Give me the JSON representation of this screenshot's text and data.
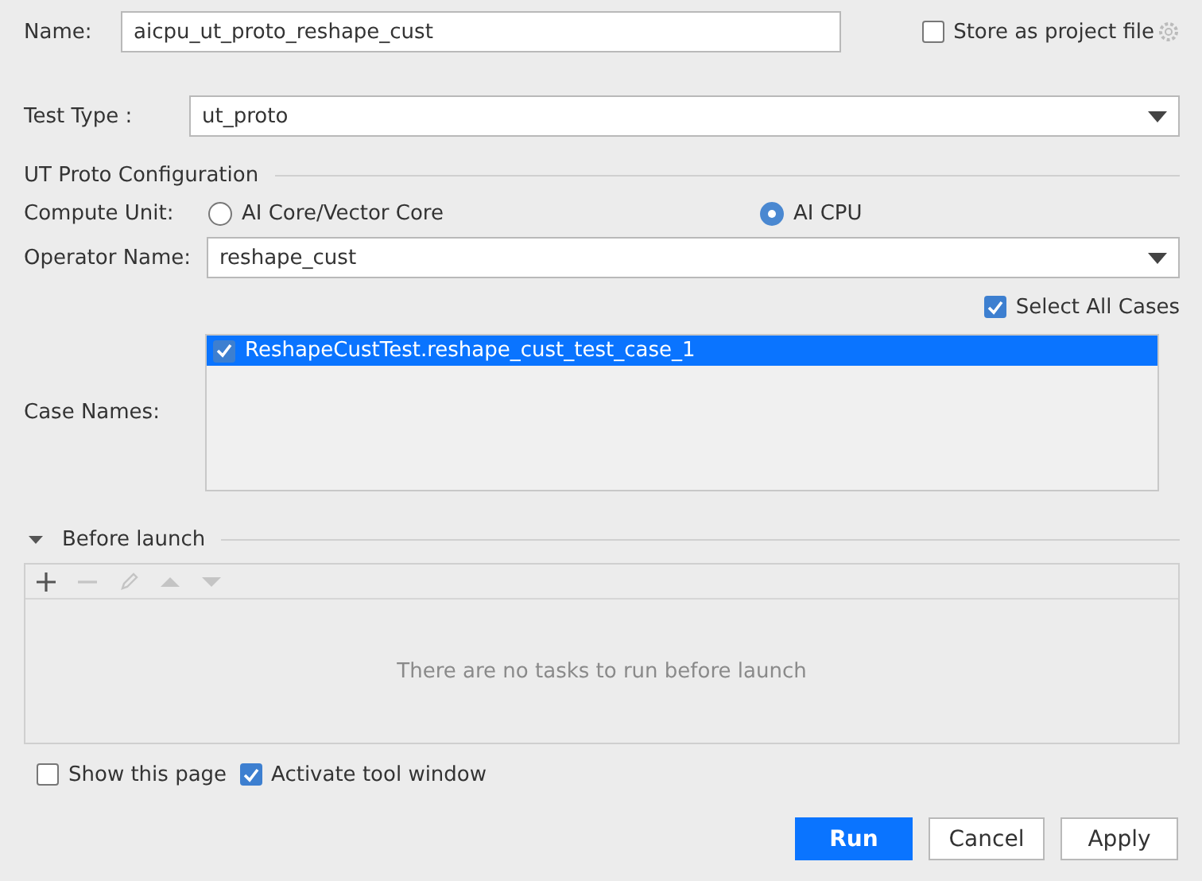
{
  "name_field": {
    "label": "Name:",
    "value": "aicpu_ut_proto_reshape_cust"
  },
  "store_as_project_file": {
    "label": "Store as project file",
    "checked": false
  },
  "test_type": {
    "label": "Test Type :",
    "value": "ut_proto"
  },
  "ut_proto_configuration": {
    "title": "UT Proto Configuration",
    "compute_unit": {
      "label": "Compute Unit:",
      "options": [
        {
          "label": "AI Core/Vector Core",
          "selected": false
        },
        {
          "label": "AI CPU",
          "selected": true
        }
      ]
    },
    "operator_name": {
      "label": "Operator Name:",
      "value": "reshape_cust"
    },
    "select_all_cases": {
      "label": "Select All Cases",
      "checked": true
    },
    "case_names": {
      "label": "Case Names:",
      "items": [
        {
          "label": "ReshapeCustTest.reshape_cust_test_case_1",
          "checked": true,
          "selected": true
        }
      ]
    }
  },
  "before_launch": {
    "title": "Before launch",
    "expanded": true,
    "toolbar": [
      {
        "kind": "add",
        "disabled": false
      },
      {
        "kind": "remove",
        "disabled": true
      },
      {
        "kind": "edit",
        "disabled": true
      },
      {
        "kind": "up",
        "disabled": true
      },
      {
        "kind": "down",
        "disabled": true
      }
    ],
    "empty_text": "There are no tasks to run before launch"
  },
  "options": [
    {
      "label": "Show this page",
      "checked": false
    },
    {
      "label": "Activate tool window",
      "checked": true
    }
  ],
  "buttons": [
    {
      "label": "Run",
      "kind": "primary"
    },
    {
      "label": "Cancel",
      "kind": "default"
    },
    {
      "label": "Apply",
      "kind": "default"
    }
  ]
}
